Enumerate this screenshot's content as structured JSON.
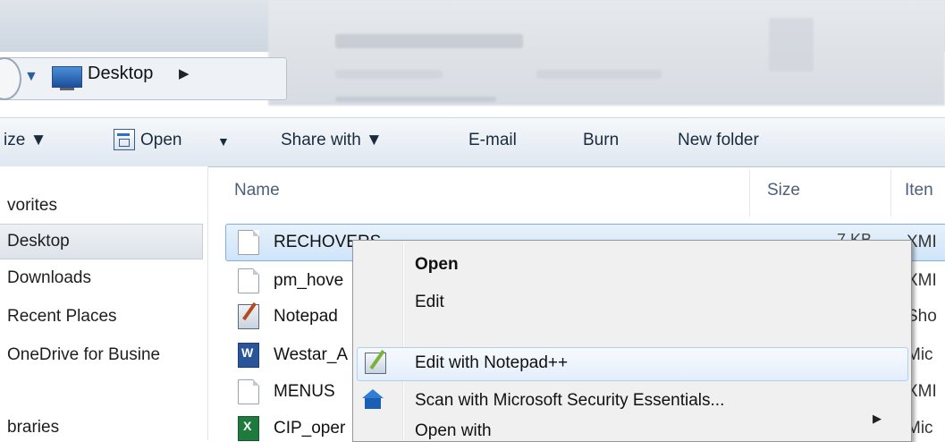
{
  "address_bar": {
    "location": "Desktop",
    "arrow": "▶"
  },
  "toolbar": {
    "organize": "ize ▼",
    "open": "Open",
    "open_dropdown": "▼",
    "share_with": "Share with ▼",
    "email": "E-mail",
    "burn": "Burn",
    "new_folder": "New folder"
  },
  "nav_pane": {
    "items": [
      "vorites",
      "Desktop",
      "Downloads",
      "Recent Places",
      "OneDrive for Busine",
      "braries"
    ],
    "selected": "Desktop"
  },
  "columns": {
    "name": "Name",
    "size": "Size",
    "type": "Iten"
  },
  "files": [
    {
      "name": "RECHOVERS",
      "size": "7 KB",
      "type": "XMI",
      "icon": "document-icon"
    },
    {
      "name": "pm_hove",
      "type": "XMI",
      "icon": "document-icon"
    },
    {
      "name": "Notepad",
      "type": "Sho",
      "icon": "notepad-shortcut-icon"
    },
    {
      "name": "Westar_A",
      "type": "Mic",
      "icon": "word-icon"
    },
    {
      "name": "MENUS",
      "type": "XMI",
      "icon": "document-icon"
    },
    {
      "name": "CIP_oper",
      "type": "Mic",
      "icon": "excel-icon"
    }
  ],
  "context_menu": {
    "items": [
      "Open",
      "Edit",
      "Edit with Notepad++",
      "Scan with Microsoft Security Essentials...",
      "Open with"
    ],
    "highlighted": "Edit with Notepad++",
    "submenu_arrow": "▶"
  }
}
